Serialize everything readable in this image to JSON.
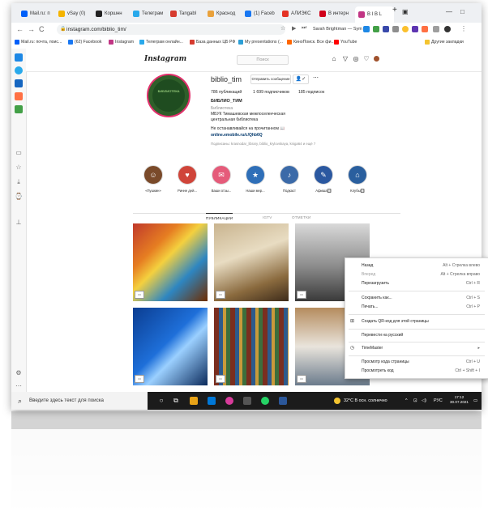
{
  "browser": {
    "tabs": [
      {
        "label": "Mail.ru: п",
        "color": "#005ff9"
      },
      {
        "label": "vSay (0)",
        "color": "#f5b400"
      },
      {
        "label": "Коршнн",
        "color": "#222222"
      },
      {
        "label": "Телеграм",
        "color": "#29a9eb"
      },
      {
        "label": "Tangabl",
        "color": "#d63b2f"
      },
      {
        "label": "Краснод",
        "color": "#e9a13b"
      },
      {
        "label": "(1) Faceb",
        "color": "#1877f2"
      },
      {
        "label": "АЛИЭКС",
        "color": "#e43225"
      },
      {
        "label": "В интерн",
        "color": "#d0021b"
      },
      {
        "label": "В I В L",
        "color": "#c13584"
      }
    ],
    "window_controls": [
      "—",
      "□"
    ],
    "url": "instagram.com/biblio_tim/",
    "sarah_ext": "Sarah Brightman — Sym",
    "bookmarks": [
      {
        "label": "Mail.ru: почта, поис...",
        "color": "#005ff9"
      },
      {
        "label": "(62) Facebook",
        "color": "#1877f2"
      },
      {
        "label": "Instagram",
        "color": "#c13584"
      },
      {
        "label": "Телеграм онлайн...",
        "color": "#29a9eb"
      },
      {
        "label": "База данных ЦБ РФ",
        "color": "#d63b2f"
      },
      {
        "label": "My presentations (...",
        "color": "#2c9fd6"
      },
      {
        "label": "КиноПоиск. Все фи...",
        "color": "#f60"
      },
      {
        "label": "YouTube",
        "color": "#ff0000"
      },
      {
        "label": "Другие закладки",
        "color": "#f4c430"
      }
    ]
  },
  "instagram": {
    "logo": "Instagram",
    "search_placeholder": "Поиск",
    "username": "biblio_tim",
    "avatar_text": "БИБЛИОТЕКА",
    "message_button": "Отправить сообщение",
    "stats": {
      "posts": "786 публикаций",
      "followers": "1 699 подписчиков",
      "following": "185 подписок"
    },
    "name": "БИБЛИО_ТИМ",
    "bio_lines": [
      "Библиотека",
      "МБУК Тимашевская межпоселенческая",
      "центральная библиотека",
      "Не останавливайся на прочитанном 📖"
    ],
    "link": "online.emobile.ru/c/Qhb6Q",
    "followed_by": "Подписаны: krasnodar_library, biblio_krylovskaya, kniga64 и ещё 7",
    "highlights": [
      {
        "label": "«Пушкин»",
        "color": "#7a4a2a"
      },
      {
        "label": "Ринне дей...",
        "color": "#d0453a"
      },
      {
        "label": "Ваши отзы...",
        "color": "#e55b7a"
      },
      {
        "label": "Наши мер...",
        "color": "#2f6fb8"
      },
      {
        "label": "Подкаст",
        "color": "#3b6aa8"
      },
      {
        "label": "Афиша🔲",
        "color": "#2b58a0"
      },
      {
        "label": "Клубы🔲",
        "color": "#2a5f9e"
      }
    ],
    "profile_tabs": [
      "ПУБЛИКАЦИИ",
      "IGTV",
      "ОТМЕТКИ"
    ]
  },
  "context_menu": {
    "items": [
      {
        "label": "Назад",
        "shortcut": "Alt + Стрелка влево",
        "disabled": false
      },
      {
        "label": "Вперед",
        "shortcut": "Alt + Стрелка вправо",
        "disabled": true
      },
      {
        "label": "Перезагрузить",
        "shortcut": "Ctrl + R",
        "disabled": false
      },
      {
        "label": "Сохранить как...",
        "shortcut": "Ctrl + S",
        "disabled": false
      },
      {
        "label": "Печать...",
        "shortcut": "Ctrl + P",
        "disabled": false
      },
      {
        "label": "Создать QR-код для этой страницы",
        "shortcut": "",
        "disabled": false
      },
      {
        "label": "Перевести на русский",
        "shortcut": "",
        "disabled": false
      },
      {
        "label": "TimeMaster",
        "shortcut": "▸",
        "disabled": false
      },
      {
        "label": "Просмотр кода страницы",
        "shortcut": "Ctrl + U",
        "disabled": false
      },
      {
        "label": "Просмотреть код",
        "shortcut": "Ctrl + Shift + I",
        "disabled": false
      }
    ]
  },
  "taskbar": {
    "search_placeholder": "Введите здесь текст для поиска",
    "weather": "32°C  В осн. солнечно",
    "lang": "РУС",
    "time": "17:12",
    "date": "30.07.2021"
  }
}
